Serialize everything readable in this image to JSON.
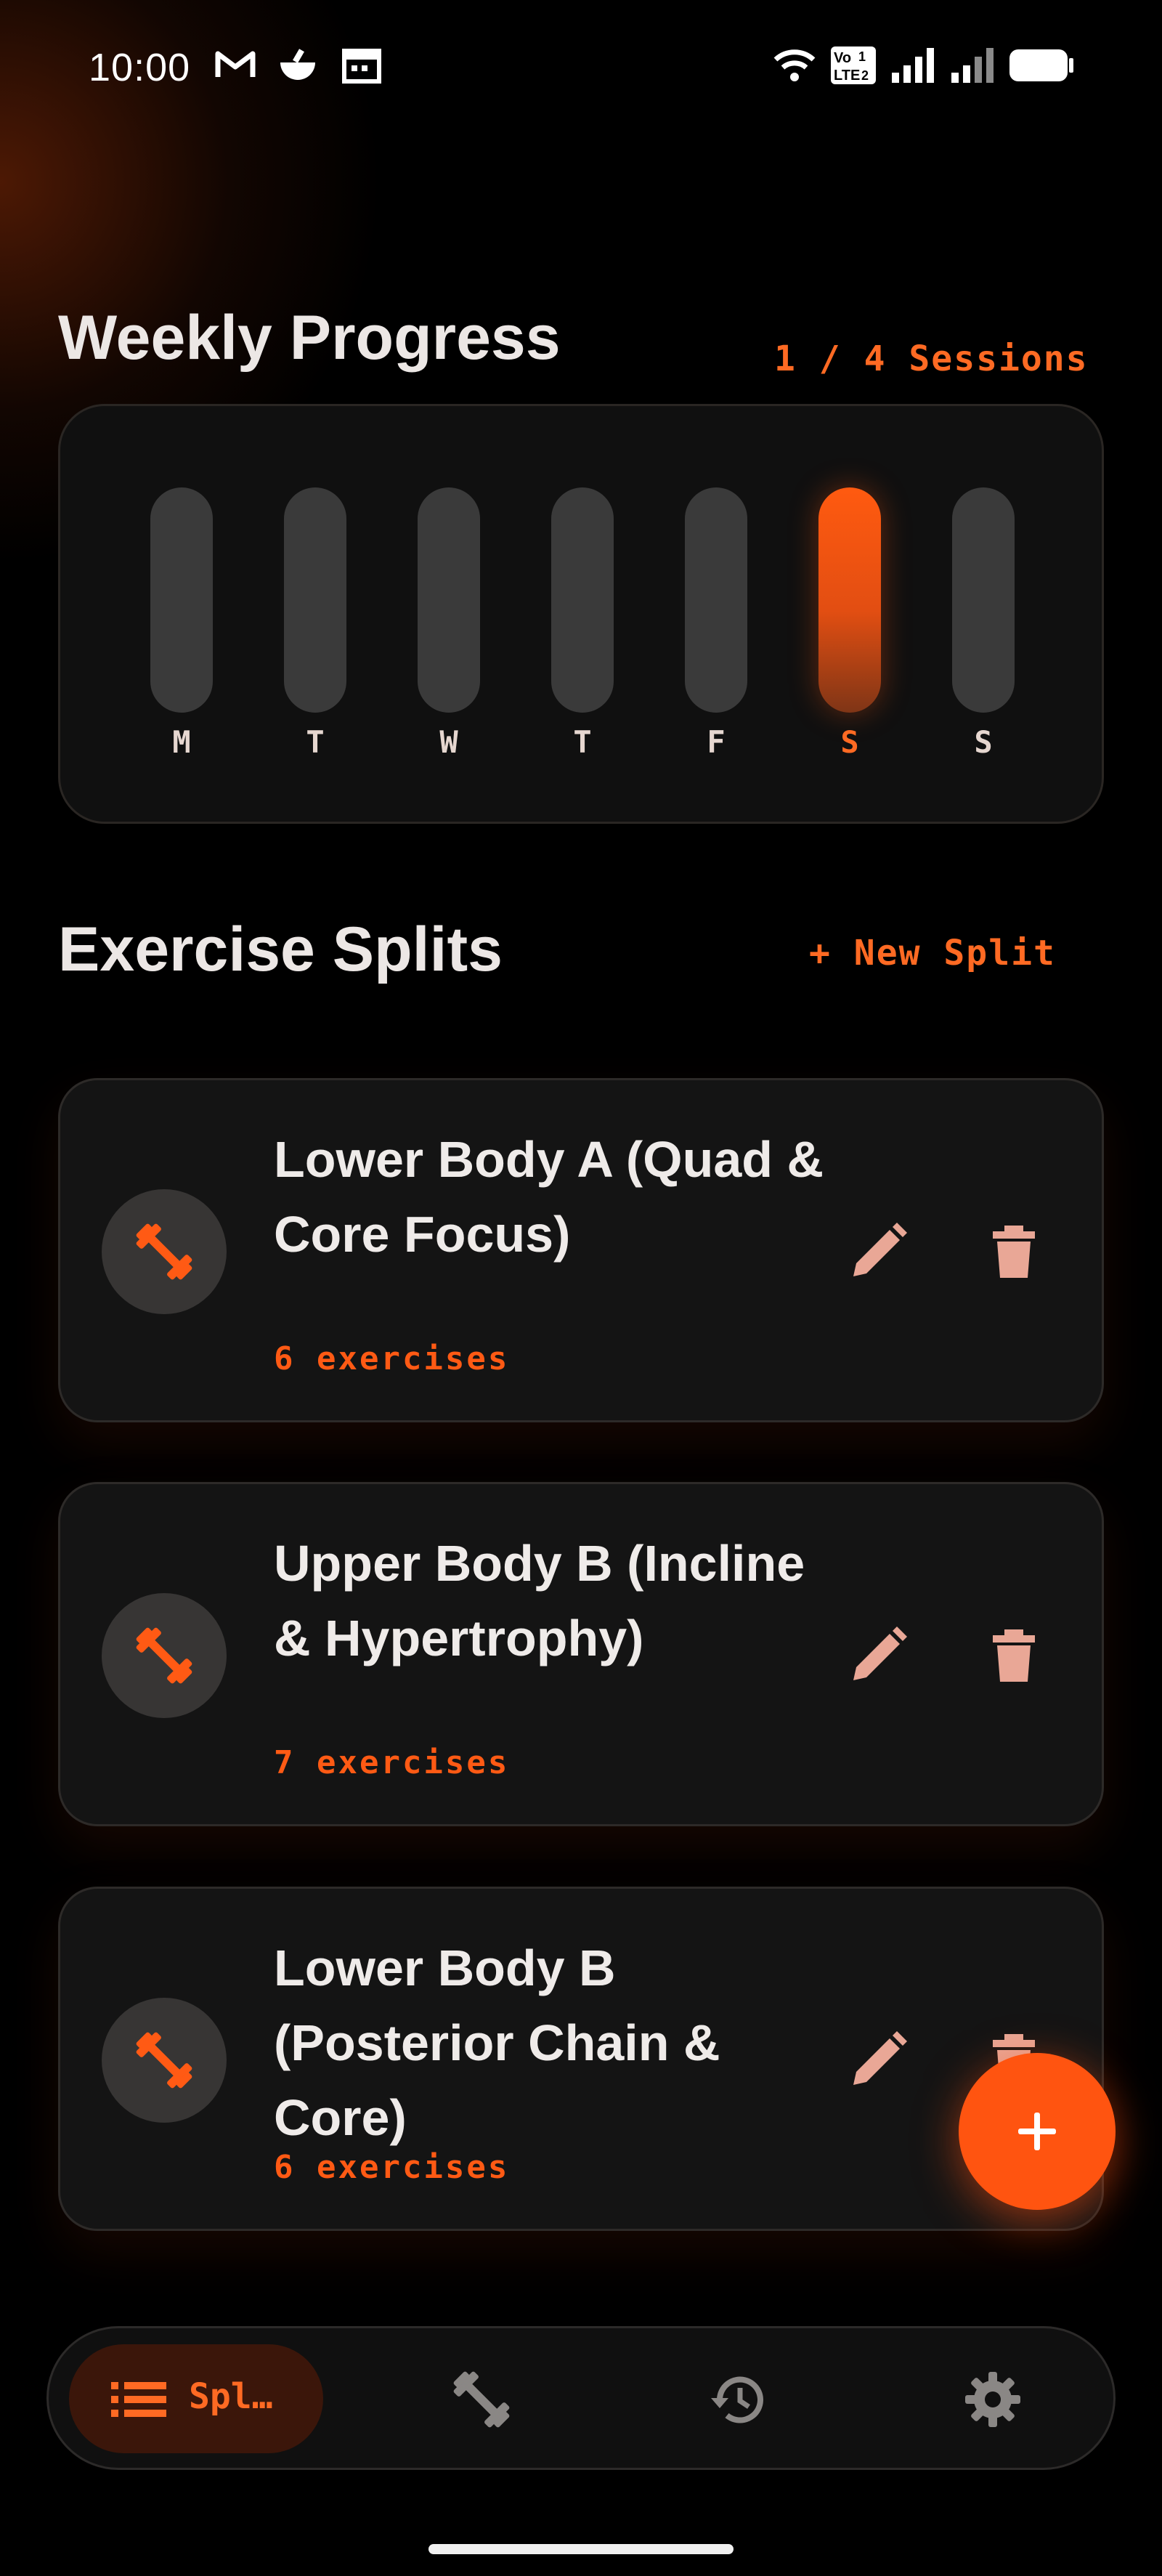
{
  "status_bar": {
    "time": "10:00",
    "volte_top": "Vo",
    "volte_bottom": "LTE",
    "sim1": "1",
    "sim2": "2"
  },
  "weekly_progress": {
    "title": "Weekly Progress",
    "sessions_label": "1 / 4 Sessions",
    "days": [
      {
        "label": "M",
        "done": false
      },
      {
        "label": "T",
        "done": false
      },
      {
        "label": "W",
        "done": false
      },
      {
        "label": "T",
        "done": false
      },
      {
        "label": "F",
        "done": false
      },
      {
        "label": "S",
        "done": true
      },
      {
        "label": "S",
        "done": false
      }
    ]
  },
  "exercise_splits": {
    "title": "Exercise Splits",
    "new_split_label": "+ New Split",
    "items": [
      {
        "name": "Lower Body A (Quad & Core Focus)",
        "count": "6 exercises",
        "icon": "dumbbell-icon"
      },
      {
        "name": "Upper Body B (Incline & Hypertrophy)",
        "count": "7 exercises",
        "icon": "dumbbell-icon"
      },
      {
        "name": "Lower Body B (Posterior Chain & Core)",
        "count": "6 exercises",
        "icon": "dumbbell-icon"
      }
    ]
  },
  "bottom_nav": {
    "items": [
      {
        "label": "Spl…",
        "icon": "list-icon",
        "active": true
      },
      {
        "label": "",
        "icon": "dumbbell-icon",
        "active": false
      },
      {
        "label": "",
        "icon": "history-icon",
        "active": false
      },
      {
        "label": "",
        "icon": "gear-icon",
        "active": false
      }
    ]
  },
  "colors": {
    "accent": "#ff5410",
    "background": "#000000",
    "card": "#141414",
    "inactive_pill": "#3a3a3a",
    "action_icon": "#e9a796"
  }
}
